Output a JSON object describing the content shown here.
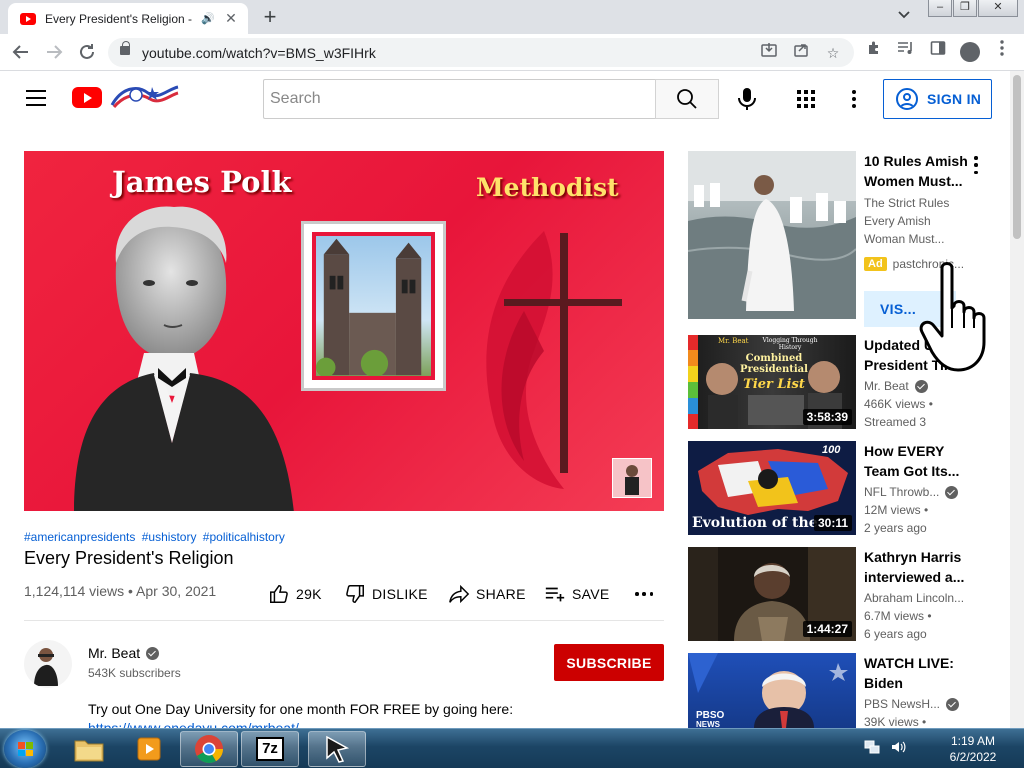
{
  "browser": {
    "tab_title": "Every President's Religion - Yo",
    "tab_audio": "🔊",
    "url": "youtube.com/watch?v=BMS_w3FIHrk"
  },
  "masthead": {
    "search_placeholder": "Search",
    "sign_in_label": "SIGN IN"
  },
  "video": {
    "thumbnail_name": "James Polk",
    "thumbnail_religion": "Methodist",
    "hashtags": [
      "#americanpresidents",
      "#ushistory",
      "#politicalhistory"
    ],
    "title": "Every President's Religion",
    "meta": "1,124,114 views • Apr 30, 2021",
    "likes": "29K",
    "dislike_label": "DISLIKE",
    "share_label": "SHARE",
    "save_label": "SAVE"
  },
  "channel": {
    "name": "Mr. Beat",
    "subscribers": "543K subscribers",
    "subscribe_label": "SUBSCRIBE",
    "description": "Try out One Day University for one month FOR FREE by going here:",
    "description_link": "https://www.onedayu.com/mrbeat/"
  },
  "ad": {
    "title": "10 Rules Amish Women Must...",
    "description": "The Strict Rules Every Amish Woman Must...",
    "badge": "Ad",
    "advertiser": "pastchronic...",
    "visit_label": "VIS..."
  },
  "recommendations": [
    {
      "title": "Updated U... President Ti...",
      "channel": "Mr. Beat",
      "verified": true,
      "views": "466K views •",
      "age": "Streamed 3",
      "duration": "3:58:39",
      "thumb_text_1": "Mr. Beat",
      "thumb_text_2": "Vlogging Through History",
      "thumb_text_3": "Combined Presidential",
      "thumb_text_4": "Tier List"
    },
    {
      "title": "How EVERY Team Got Its...",
      "channel": "NFL Throwb...",
      "verified": true,
      "views": "12M views •",
      "age": "2 years ago",
      "duration": "30:11",
      "thumb_text_1": "Evolution of the",
      "thumb_text_2": "100"
    },
    {
      "title": "Kathryn Harris interviewed a...",
      "channel": "Abraham Lincoln...",
      "verified": false,
      "views": "6.7M views •",
      "age": "6 years ago",
      "duration": "1:44:27"
    },
    {
      "title": "WATCH LIVE: Biden delivers...",
      "channel": "PBS NewsH...",
      "verified": true,
      "views": "39K views •",
      "age": "",
      "duration": "",
      "thumb_text_1": "PBSO",
      "thumb_text_2": "NEWS"
    }
  ],
  "taskbar": {
    "time": "1:19 AM",
    "date": "6/2/2022",
    "app_7zip": "7z"
  },
  "colors": {
    "youtube_red": "#ff0000",
    "link_blue": "#065fd4",
    "subscribe_red": "#cc0000",
    "ad_yellow": "#f2c31b"
  }
}
